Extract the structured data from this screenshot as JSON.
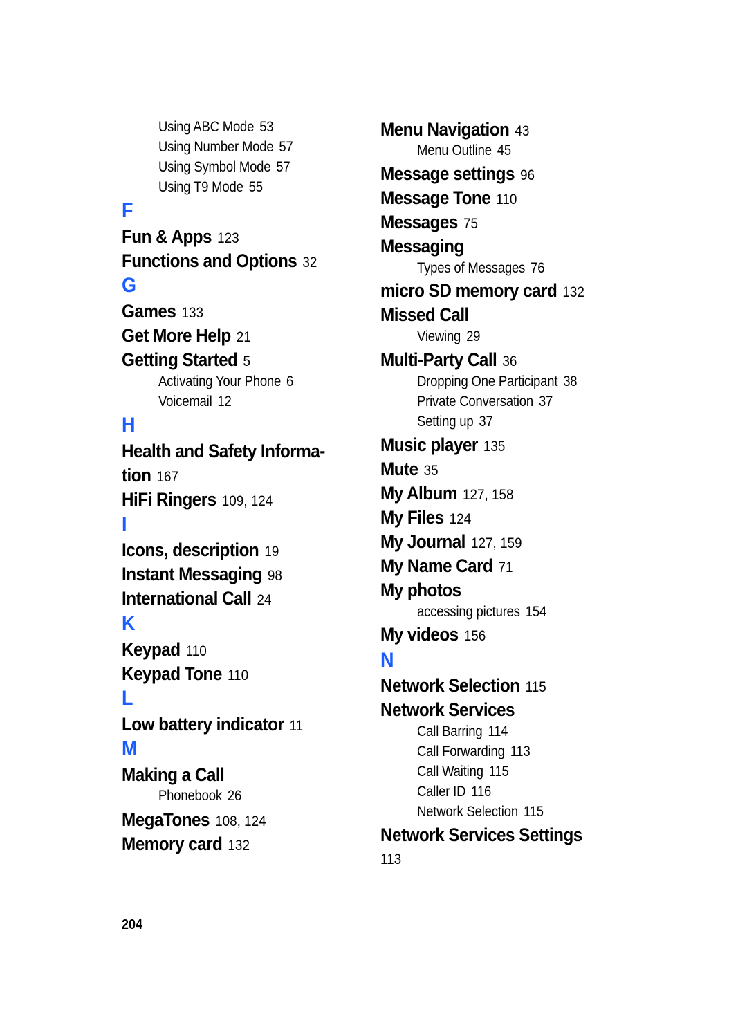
{
  "accent_color": "#1a5cff",
  "page_number": "204",
  "left_column": [
    {
      "type": "sub",
      "text": "Using ABC Mode",
      "pages": "53"
    },
    {
      "type": "sub",
      "text": "Using Number Mode",
      "pages": "57"
    },
    {
      "type": "sub",
      "text": "Using Symbol Mode",
      "pages": "57"
    },
    {
      "type": "sub",
      "text": "Using T9 Mode",
      "pages": "55"
    },
    {
      "type": "letter",
      "text": "F"
    },
    {
      "type": "main",
      "text": "Fun & Apps",
      "pages": "123"
    },
    {
      "type": "main",
      "text": "Functions and Options",
      "pages": "32"
    },
    {
      "type": "letter",
      "text": "G"
    },
    {
      "type": "main",
      "text": "Games",
      "pages": "133"
    },
    {
      "type": "main",
      "text": "Get More Help",
      "pages": "21"
    },
    {
      "type": "main",
      "text": "Getting Started",
      "pages": "5"
    },
    {
      "type": "sub",
      "text": "Activating Your Phone",
      "pages": "6"
    },
    {
      "type": "sub",
      "text": "Voicemail",
      "pages": "12"
    },
    {
      "type": "letter",
      "text": "H"
    },
    {
      "type": "main",
      "text": "Health and Safety Informa-",
      "pages": ""
    },
    {
      "type": "main",
      "text": "tion",
      "pages": "167"
    },
    {
      "type": "main",
      "text": "HiFi Ringers",
      "pages": "109, 124"
    },
    {
      "type": "letter",
      "text": "I"
    },
    {
      "type": "main",
      "text": "Icons, description",
      "pages": "19"
    },
    {
      "type": "main",
      "text": "Instant Messaging",
      "pages": "98"
    },
    {
      "type": "main",
      "text": "International Call",
      "pages": "24"
    },
    {
      "type": "letter",
      "text": "K"
    },
    {
      "type": "main",
      "text": "Keypad",
      "pages": "110"
    },
    {
      "type": "main",
      "text": "Keypad Tone",
      "pages": "110"
    },
    {
      "type": "letter",
      "text": "L"
    },
    {
      "type": "main",
      "text": "Low battery indicator",
      "pages": "11"
    },
    {
      "type": "letter",
      "text": "M"
    },
    {
      "type": "main",
      "text": "Making a Call",
      "pages": ""
    },
    {
      "type": "sub",
      "text": "Phonebook",
      "pages": "26"
    },
    {
      "type": "main",
      "text": "MegaTones",
      "pages": "108, 124"
    },
    {
      "type": "main",
      "text": "Memory card",
      "pages": "132"
    }
  ],
  "right_column": [
    {
      "type": "main",
      "text": "Menu Navigation",
      "pages": "43"
    },
    {
      "type": "sub",
      "text": "Menu Outline",
      "pages": "45"
    },
    {
      "type": "main",
      "text": "Message settings",
      "pages": "96"
    },
    {
      "type": "main",
      "text": "Message Tone",
      "pages": "110"
    },
    {
      "type": "main",
      "text": "Messages",
      "pages": "75"
    },
    {
      "type": "main",
      "text": "Messaging",
      "pages": ""
    },
    {
      "type": "sub",
      "text": "Types of Messages",
      "pages": "76"
    },
    {
      "type": "main",
      "text": "micro SD memory card",
      "pages": "132"
    },
    {
      "type": "main",
      "text": "Missed Call",
      "pages": ""
    },
    {
      "type": "sub",
      "text": "Viewing",
      "pages": "29"
    },
    {
      "type": "main",
      "text": "Multi-Party Call",
      "pages": "36"
    },
    {
      "type": "sub",
      "text": "Dropping One Participant",
      "pages": "38"
    },
    {
      "type": "sub",
      "text": "Private Conversation",
      "pages": "37"
    },
    {
      "type": "sub",
      "text": "Setting up",
      "pages": "37"
    },
    {
      "type": "main",
      "text": "Music player",
      "pages": "135"
    },
    {
      "type": "main",
      "text": "Mute",
      "pages": "35"
    },
    {
      "type": "main",
      "text": "My Album",
      "pages": "127, 158"
    },
    {
      "type": "main",
      "text": "My Files",
      "pages": "124"
    },
    {
      "type": "main",
      "text": "My Journal",
      "pages": "127, 159"
    },
    {
      "type": "main",
      "text": "My Name Card",
      "pages": "71"
    },
    {
      "type": "main",
      "text": "My photos",
      "pages": ""
    },
    {
      "type": "sub",
      "text": "accessing pictures",
      "pages": "154"
    },
    {
      "type": "main",
      "text": "My videos",
      "pages": "156"
    },
    {
      "type": "letter",
      "text": "N"
    },
    {
      "type": "main",
      "text": "Network Selection",
      "pages": "115"
    },
    {
      "type": "main",
      "text": "Network Services",
      "pages": ""
    },
    {
      "type": "sub",
      "text": "Call Barring",
      "pages": "114"
    },
    {
      "type": "sub",
      "text": "Call Forwarding",
      "pages": "113"
    },
    {
      "type": "sub",
      "text": "Call Waiting",
      "pages": "115"
    },
    {
      "type": "sub",
      "text": "Caller ID",
      "pages": "116"
    },
    {
      "type": "sub",
      "text": "Network Selection",
      "pages": "115"
    },
    {
      "type": "main",
      "text": "Network Services Settings",
      "pages": ""
    },
    {
      "type": "plain",
      "text": "113",
      "pages": ""
    }
  ]
}
